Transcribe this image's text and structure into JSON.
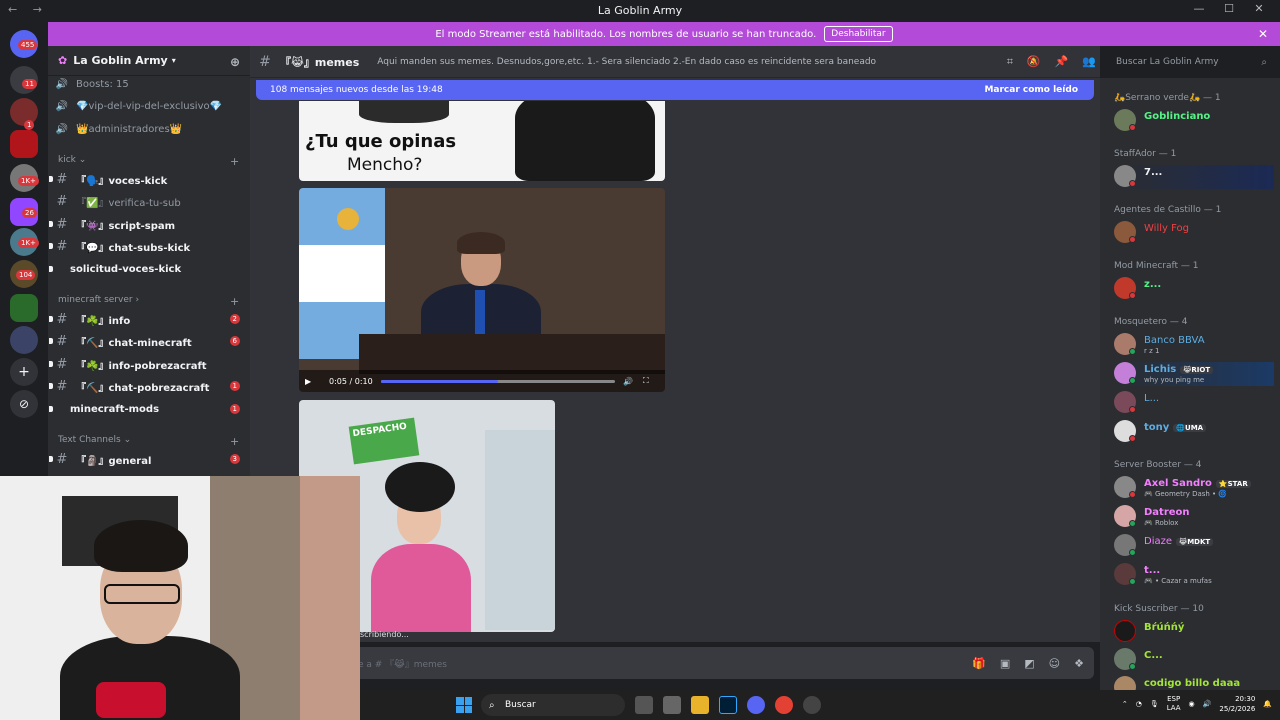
{
  "window": {
    "title": "La Goblin Army",
    "nav": "←  →",
    "controls": [
      "—",
      "☐",
      "✕"
    ]
  },
  "banner": {
    "text": "El modo Streamer está habilitado. Los nombres de usuario se han truncado.",
    "button": "Deshabilitar",
    "close": "✕"
  },
  "servers": {
    "badges": [
      "455",
      "11",
      "1",
      "1K+",
      "26",
      "1K+",
      "104"
    ]
  },
  "sidebar": {
    "guild_name": "La Goblin Army",
    "rows_top": [
      {
        "icon": "🔊",
        "label": "Boosts: 15"
      },
      {
        "icon": "🔊",
        "label": "💎vip-del-vip-del-exclusivo💎"
      },
      {
        "icon": "🔊",
        "label": "👑administradores👑"
      }
    ],
    "categories": [
      "kick",
      "minecraft server",
      "Text Channels"
    ],
    "kick": [
      {
        "label": "『🗣️』voces-kick",
        "unread": true
      },
      {
        "label": "『✅』verifica-tu-sub",
        "unread": false
      },
      {
        "label": "『👾』script-spam",
        "unread": true
      },
      {
        "label": "『💬』chat-subs-kick",
        "unread": true
      },
      {
        "label": "solicitud-voces-kick",
        "unread": true
      }
    ],
    "minecraft": [
      {
        "label": "『☘️』info",
        "count": "2"
      },
      {
        "label": "『⛏️』chat-minecraft",
        "count": "6"
      },
      {
        "label": "『☘️』info-pobrezacraft",
        "count": ""
      },
      {
        "label": "『⛏️』chat-pobrezacraft",
        "count": "1"
      },
      {
        "label": "minecraft-mods",
        "count": "1"
      }
    ],
    "text": [
      {
        "label": "『🗿』general",
        "count": "3"
      }
    ]
  },
  "header": {
    "channel": "『😹』memes",
    "topic": "Aqui manden sus memes. Desnudos,gore,etc. 1.- Sera silenciado 2.-En dado caso es reincidente sera baneado",
    "search_placeholder": "Buscar La Goblin Army"
  },
  "chat": {
    "new_messages": "108 mensajes nuevos desde las 19:48",
    "mark_read": "Marcar como leído",
    "meme_text_1": "¿Tu que opinas",
    "meme_text_2": "Mencho?",
    "video_time": "0:05 / 0:10",
    "video_progress": 0.5,
    "photo_sign": "DESPACHO",
    "typing": "scribiendo...",
    "composer_placeholder": "e a # 『😹』memes"
  },
  "members": {
    "groups": [
      {
        "title": "🛵Serrano verde🛵 — 1",
        "members": [
          {
            "name": "Goblinciano",
            "color": "#57f287",
            "activity": "",
            "tag": ""
          }
        ]
      },
      {
        "title": "StaffAdor — 1",
        "members": [
          {
            "name": "7...",
            "color": "#f2f3f5",
            "activity": "",
            "tag": ""
          }
        ]
      },
      {
        "title": "Agentes de Castillo — 1",
        "members": [
          {
            "name": "Willy Fog",
            "color": "#ed4245",
            "activity": "",
            "tag": ""
          }
        ]
      },
      {
        "title": "Mod Minecraft — 1",
        "members": [
          {
            "name": "z...",
            "color": "#57f287",
            "activity": "",
            "tag": ""
          }
        ]
      },
      {
        "title": "Mosquetero — 4",
        "members": [
          {
            "name": "Banco BBVA",
            "color": "#5dade2",
            "activity": "r z 1",
            "tag": ""
          },
          {
            "name": "Lichis",
            "color": "#5dade2",
            "activity": "why you ping me",
            "tag": "😹RIOT"
          },
          {
            "name": "L...",
            "color": "#5dade2",
            "activity": "",
            "tag": ""
          },
          {
            "name": "tony",
            "color": "#5dade2",
            "activity": "",
            "tag": "🌐UMA"
          }
        ]
      },
      {
        "title": "Server Booster — 4",
        "members": [
          {
            "name": "Axel Sandro",
            "color": "#f47fff",
            "activity": "🎮 Geometry Dash • 🌀",
            "tag": "⭐STAR"
          },
          {
            "name": "Datreon",
            "color": "#f47fff",
            "activity": "🎮 Roblox",
            "tag": ""
          },
          {
            "name": "Diaze",
            "color": "#f47fff",
            "activity": "",
            "tag": "😹MDKT"
          },
          {
            "name": "t...",
            "color": "#f47fff",
            "activity": "🎮 • Cazar a mufas",
            "tag": ""
          }
        ]
      },
      {
        "title": "Kick Suscriber — 10",
        "members": [
          {
            "name": "Вŕúńńý",
            "color": "#a3e635",
            "activity": "",
            "tag": ""
          },
          {
            "name": "C...",
            "color": "#a3e635",
            "activity": "",
            "tag": ""
          },
          {
            "name": "codigo billo daaa",
            "color": "#a3e635",
            "activity": "",
            "tag": ""
          }
        ]
      }
    ]
  },
  "taskbar": {
    "search": "Buscar",
    "lang": "ESP",
    "lang2": "LAA",
    "time": "20:30",
    "date": "25/2/2026"
  },
  "colors": {
    "banner": "#b34bd8",
    "blurple": "#5865f2",
    "unread": "#da373c"
  }
}
